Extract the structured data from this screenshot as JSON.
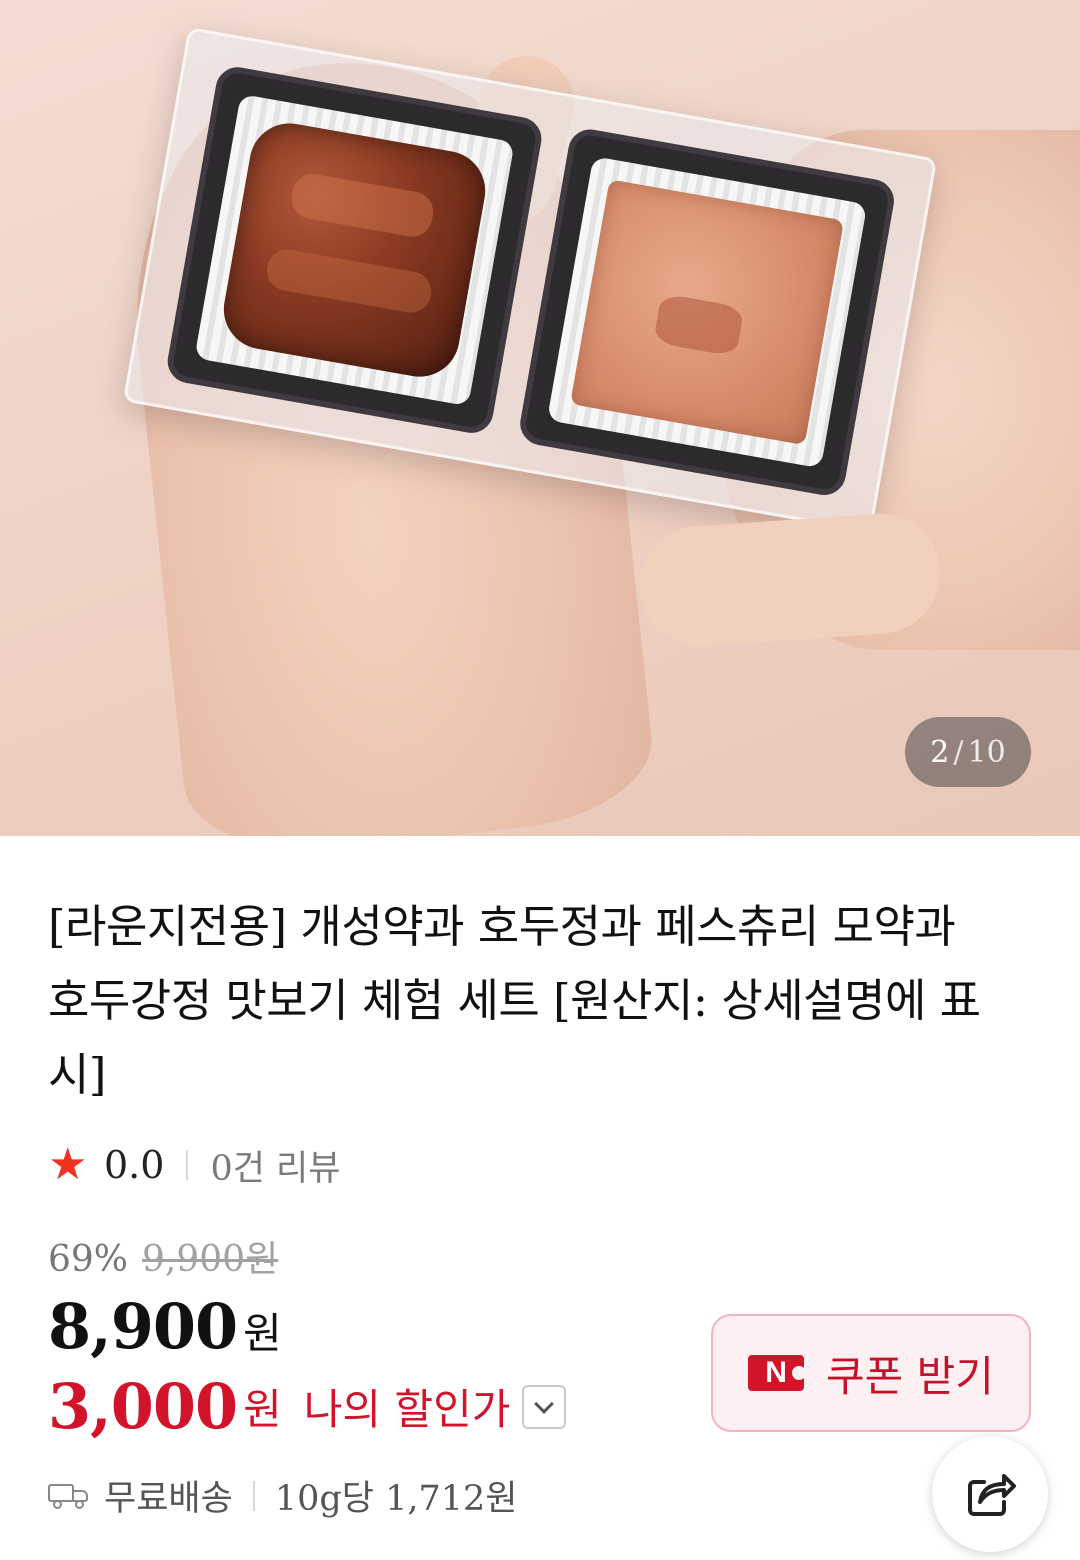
{
  "gallery": {
    "current": "2",
    "separator": "/",
    "total": "10"
  },
  "product": {
    "title": "[라운지전용] 개성약과 호두정과 페스츄리 모약과 호두강정 맛보기 체험 세트 [원산지: 상세설명에 표시]",
    "rating": "0.0",
    "review_count": "0건 리뷰",
    "discount_rate": "69%",
    "original_price": "9,900원",
    "price": "8,900",
    "price_unit": "원",
    "my_discount_price": "3,000",
    "my_discount_unit": "원",
    "my_discount_label": "나의 할인가",
    "shipping": "무료배송",
    "unit_price": "10g당 1,712원"
  },
  "coupon": {
    "badge": "N",
    "label": "쿠폰 받기"
  },
  "colors": {
    "accent_red": "#d2142a",
    "star": "#f0331f",
    "coupon_bg": "#fdf0f2"
  },
  "icons": [
    "star-icon",
    "chevron-down-icon",
    "n-icon",
    "truck-icon",
    "share-icon"
  ]
}
